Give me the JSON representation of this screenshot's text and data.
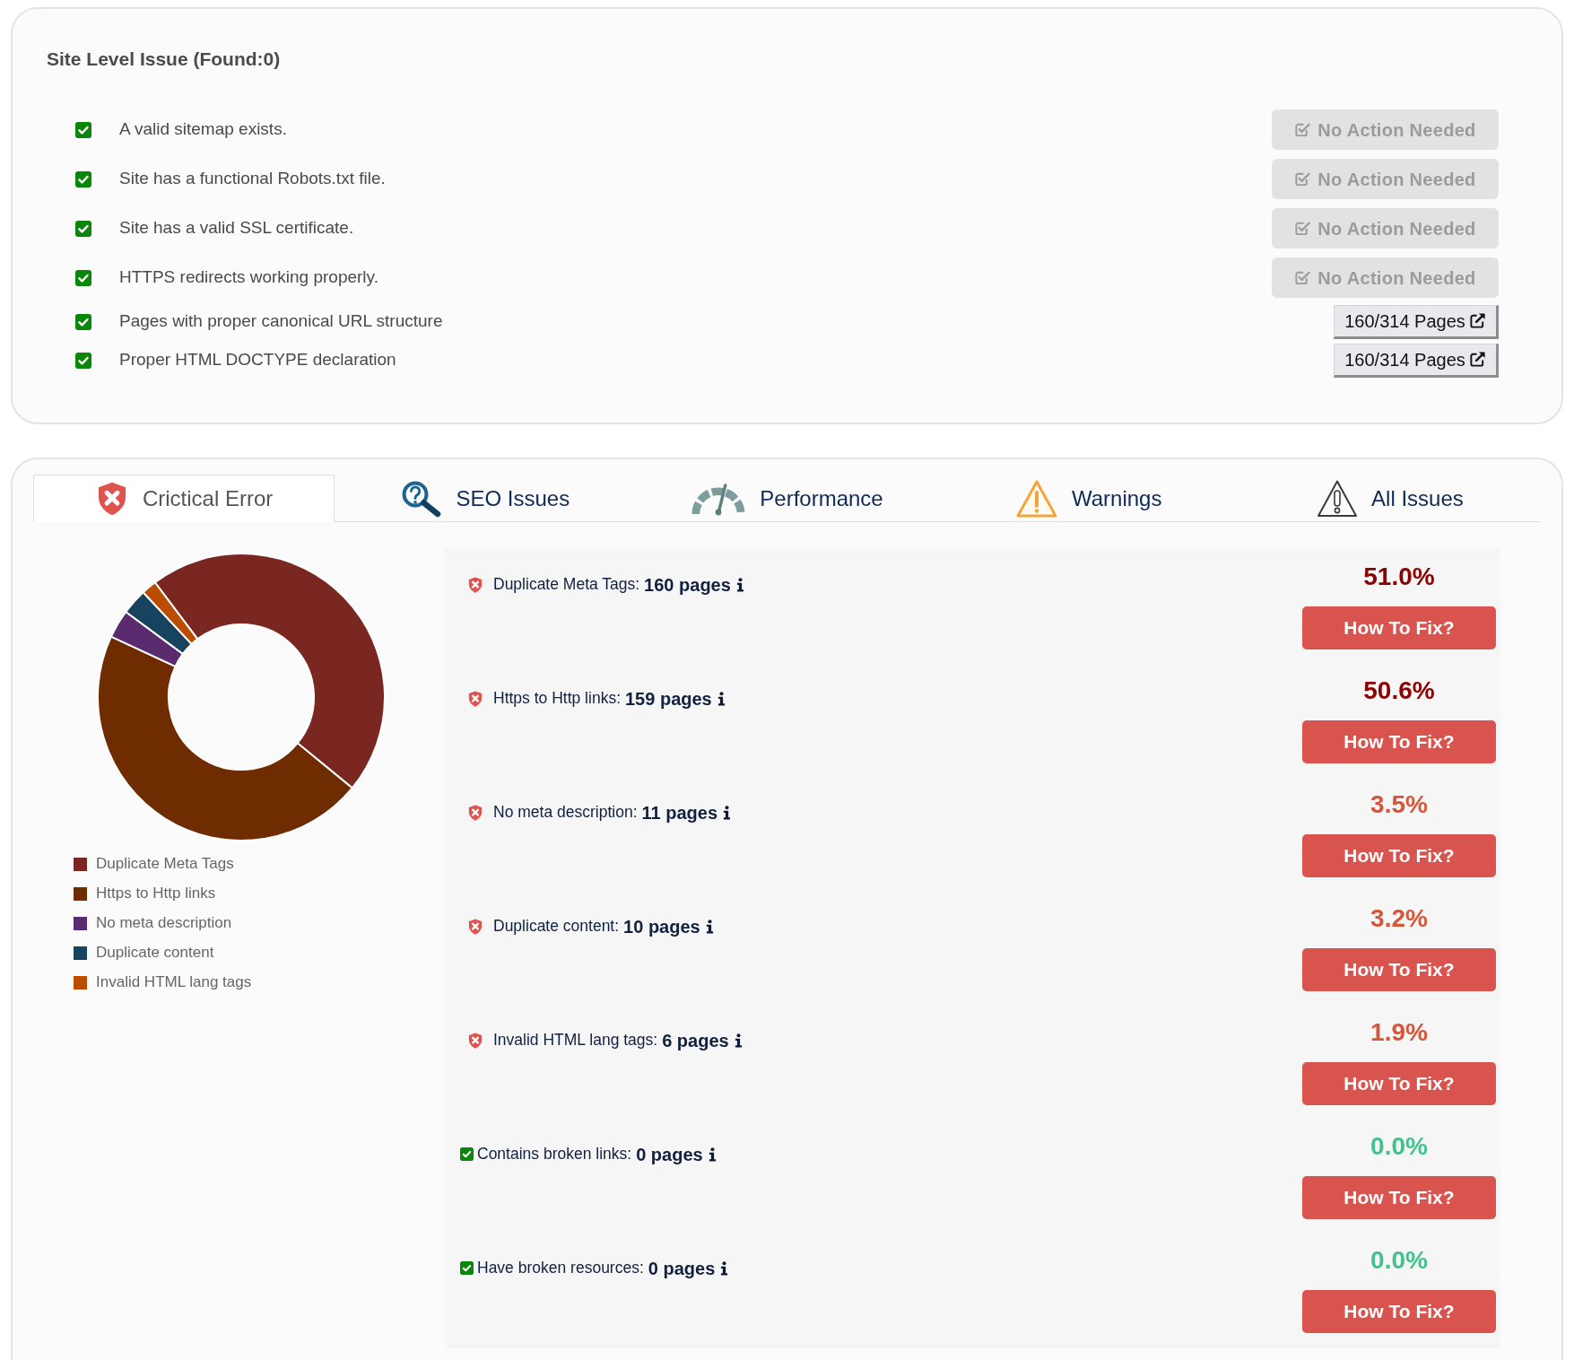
{
  "site_level": {
    "title": "Site Level Issue (Found:0)",
    "checks": [
      {
        "text": "A valid sitemap exists.",
        "checked": true,
        "action": {
          "kind": "status",
          "label": "No Action Needed"
        }
      },
      {
        "text": "Site has a functional Robots.txt file.",
        "checked": true,
        "action": {
          "kind": "status",
          "label": "No Action Needed"
        }
      },
      {
        "text": "Site has a valid SSL certificate.",
        "checked": true,
        "action": {
          "kind": "status",
          "label": "No Action Needed"
        }
      },
      {
        "text": "HTTPS redirects working properly.",
        "checked": true,
        "action": {
          "kind": "status",
          "label": "No Action Needed"
        }
      },
      {
        "text": "Pages with proper canonical URL structure",
        "checked": true,
        "action": {
          "kind": "link",
          "label": "160/314 Pages"
        }
      },
      {
        "text": "Proper HTML DOCTYPE declaration",
        "checked": true,
        "action": {
          "kind": "link",
          "label": "160/314 Pages"
        }
      }
    ]
  },
  "issues_panel": {
    "tabs": [
      {
        "kind": "critical",
        "label": "Crictical Error",
        "selected": true
      },
      {
        "kind": "seo",
        "label": "SEO Issues",
        "selected": false
      },
      {
        "kind": "performance",
        "label": "Performance",
        "selected": false
      },
      {
        "kind": "warnings",
        "label": "Warnings",
        "selected": false
      },
      {
        "kind": "all",
        "label": "All Issues",
        "selected": false
      }
    ],
    "chart": {
      "chart_data": {
        "type": "donut",
        "categories": [
          "Duplicate Meta Tags",
          "Https to Http links",
          "No meta description",
          "Duplicate content",
          "Invalid HTML lang tags"
        ],
        "values": [
          46.2,
          46.0,
          3.2,
          2.9,
          1.7
        ],
        "colors": [
          "#7b2721",
          "#6f2c00",
          "#5b2b6f",
          "#17435f",
          "#bb4c00"
        ],
        "legend": "bottom"
      }
    },
    "issues": [
      {
        "kind": "high",
        "label": "Duplicate Meta Tags:",
        "count": "160 pages",
        "percent": "51.0%",
        "button": "How To Fix?"
      },
      {
        "kind": "high",
        "label": "Https to Http links:",
        "count": "159 pages",
        "percent": "50.6%",
        "button": "How To Fix?"
      },
      {
        "kind": "medium",
        "label": "No meta description:",
        "count": "11 pages",
        "percent": "3.5%",
        "button": "How To Fix?"
      },
      {
        "kind": "medium",
        "label": "Duplicate content:",
        "count": "10 pages",
        "percent": "3.2%",
        "button": "How To Fix?"
      },
      {
        "kind": "medium",
        "label": "Invalid HTML lang tags:",
        "count": "6 pages",
        "percent": "1.9%",
        "button": "How To Fix?"
      },
      {
        "kind": "ok",
        "label": "Contains broken links:",
        "count": "0 pages",
        "percent": "0.0%",
        "button": "How To Fix?"
      },
      {
        "kind": "ok",
        "label": "Have broken resources:",
        "count": "0 pages",
        "percent": "0.0%",
        "button": "How To Fix?"
      }
    ]
  }
}
